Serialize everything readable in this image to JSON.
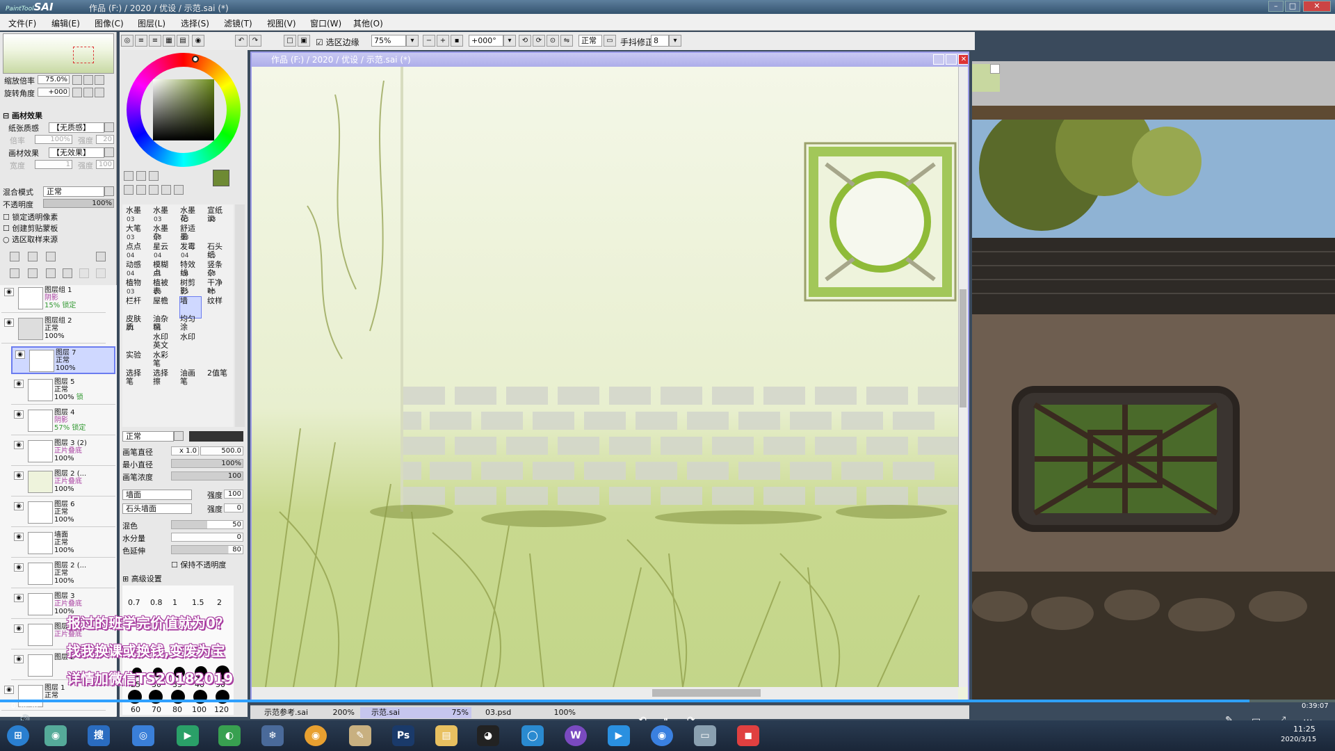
{
  "app": {
    "logo": "SAI",
    "logo_prefix": "PaintTool",
    "document_title": "作品 (F:) / 2020 / 优设 / 示范.sai (*)"
  },
  "menu": [
    "文件(F)",
    "编辑(E)",
    "图像(C)",
    "图层(L)",
    "选择(S)",
    "滤镜(T)",
    "视图(V)",
    "窗口(W)",
    "其他(O)"
  ],
  "toolbar": {
    "selection_edge": "选区边缘",
    "zoom": "75%",
    "rotation": "+000°",
    "mode": "正常",
    "stabilizer_label": "手抖修正",
    "stabilizer": "8"
  },
  "navigator": {
    "zoom_label": "缩放倍率",
    "zoom_value": "75.0%",
    "angle_label": "旋转角度",
    "angle_value": "+000"
  },
  "material": {
    "section": "画材效果",
    "paper_label": "纸张质感",
    "paper_value": "【无质感】",
    "mag_label": "倍率",
    "mag_value": "100%",
    "strength_label": "强度",
    "strength_value": "20",
    "effect_label": "画材效果",
    "effect_value": "【无效果】",
    "width_label": "宽度",
    "width_value": "1",
    "effect_strength_label": "强度",
    "effect_strength_value": "100"
  },
  "blend": {
    "mode_label": "混合模式",
    "mode_value": "正常",
    "opacity_label": "不透明度",
    "opacity_value": "100%",
    "opts": [
      "锁定透明像素",
      "创建剪贴蒙板",
      "选区取样来源"
    ]
  },
  "layers": [
    {
      "name": "图层组 1",
      "mode": "阴影",
      "op": "15%",
      "extra": "锁定"
    },
    {
      "name": "图层组 2",
      "mode": "正常",
      "op": "100%",
      "extra": ""
    },
    {
      "name": "图层 7",
      "mode": "正常",
      "op": "100%",
      "extra": ""
    },
    {
      "name": "图层 5",
      "mode": "正常",
      "op": "100%",
      "extra": "锁"
    },
    {
      "name": "图层 4",
      "mode": "阴影",
      "op": "57%",
      "extra": "锁定"
    },
    {
      "name": "图层 3 (2)",
      "mode": "正片叠底",
      "op": "100%",
      "extra": ""
    },
    {
      "name": "图层 2 (...",
      "mode": "正片叠底",
      "op": "100%",
      "extra": ""
    },
    {
      "name": "图层 6",
      "mode": "正常",
      "op": "100%",
      "extra": ""
    },
    {
      "name": "墙面",
      "mode": "正常",
      "op": "100%",
      "extra": ""
    },
    {
      "name": "图层 2 (...",
      "mode": "正常",
      "op": "100%",
      "extra": ""
    },
    {
      "name": "图层 3",
      "mode": "正片叠底",
      "op": "100%",
      "extra": ""
    },
    {
      "name": "图层",
      "mode": "正片叠底",
      "op": "",
      "extra": ""
    },
    {
      "name": "图层 2",
      "mode": "",
      "op": "",
      "extra": ""
    },
    {
      "name": "图层 1",
      "mode": "正常",
      "op": "",
      "extra": ""
    }
  ],
  "brushes": [
    {
      "n": "水墨",
      "s": "03"
    },
    {
      "n": "水墨",
      "s": "03"
    },
    {
      "n": "水墨花",
      "s": "03"
    },
    {
      "n": "宣纸淡",
      "s": "03"
    },
    {
      "n": "大笔",
      "s": "03"
    },
    {
      "n": "水墨杂",
      "s": "03"
    },
    {
      "n": "舒适墨",
      "s": "03"
    },
    {
      "n": "",
      "s": ""
    },
    {
      "n": "点点",
      "s": "04"
    },
    {
      "n": "星云",
      "s": "04"
    },
    {
      "n": "发霉",
      "s": "04"
    },
    {
      "n": "石头纸",
      "s": "05"
    },
    {
      "n": "动感",
      "s": "04"
    },
    {
      "n": "模糊点",
      "s": "01"
    },
    {
      "n": "特效线",
      "s": "04"
    },
    {
      "n": "竖条杂",
      "s": "03"
    },
    {
      "n": "植物",
      "s": "03"
    },
    {
      "n": "植被表",
      "s": "05"
    },
    {
      "n": "树剪影",
      "s": "05"
    },
    {
      "n": "干净叶",
      "s": "05"
    },
    {
      "n": "栏杆",
      "s": ""
    },
    {
      "n": "屋檐",
      "s": ""
    },
    {
      "n": "墙",
      "s": ""
    },
    {
      "n": "纹样",
      "s": ""
    },
    {
      "n": "皮肤质",
      "s": "01"
    },
    {
      "n": "油杂糯",
      "s": "01"
    },
    {
      "n": "均匀涂",
      "s": ""
    },
    {
      "n": "",
      "s": ""
    },
    {
      "n": "",
      "s": ""
    },
    {
      "n": "水印 英文",
      "s": ""
    },
    {
      "n": "水印",
      "s": ""
    },
    {
      "n": "",
      "s": ""
    },
    {
      "n": "实验",
      "s": ""
    },
    {
      "n": "水彩笔",
      "s": ""
    },
    {
      "n": "",
      "s": ""
    },
    {
      "n": "",
      "s": ""
    },
    {
      "n": "选择笔",
      "s": ""
    },
    {
      "n": "选择擦",
      "s": ""
    },
    {
      "n": "油画笔",
      "s": ""
    },
    {
      "n": "2值笔",
      "s": ""
    }
  ],
  "brush_settings": {
    "mode": "正常",
    "size_label": "画笔直径",
    "size_mult": "x 1.0",
    "size_value": "500.0",
    "min_label": "最小直径",
    "min_value": "100%",
    "density_label": "画笔浓度",
    "density_value": "100",
    "texture1": "墙面",
    "texture1_label": "强度",
    "texture1_value": "100",
    "texture2": "石头墙面",
    "texture2_label": "强度",
    "texture2_value": "0",
    "blend_label": "混色",
    "blend_value": "50",
    "water_label": "水分量",
    "water_value": "0",
    "color_ext_label": "色延伸",
    "color_ext_value": "80",
    "keep_opacity": "保持不透明度",
    "advanced": "高级设置",
    "sizes_row1": [
      "0.7",
      "0.8",
      "1",
      "1.5",
      "2"
    ],
    "sizes_row3": [
      "25",
      "30",
      "35",
      "40",
      "50"
    ],
    "sizes_row4": [
      "60",
      "70",
      "80",
      "100",
      "120"
    ]
  },
  "subtitles": [
    "报过的班学完价值就为0？",
    "找我换课或换钱,变废为宝",
    "详情加微信TS20182019"
  ],
  "file_tabs": [
    {
      "name": "示范参考.sai",
      "zoom": "200%"
    },
    {
      "name": "示范.sai",
      "zoom": "75%"
    },
    {
      "name": "03.psd",
      "zoom": "100%"
    }
  ],
  "video": {
    "elapsed": "0:36:38",
    "total": "0:39:07"
  },
  "clock": {
    "time": "11:25",
    "date": "2020/3/15"
  },
  "colors": {
    "primary": "#6e8a34",
    "secondary": "#a9c66a",
    "canvas_bg": "#eef3dc",
    "accent": "#a83da0"
  }
}
